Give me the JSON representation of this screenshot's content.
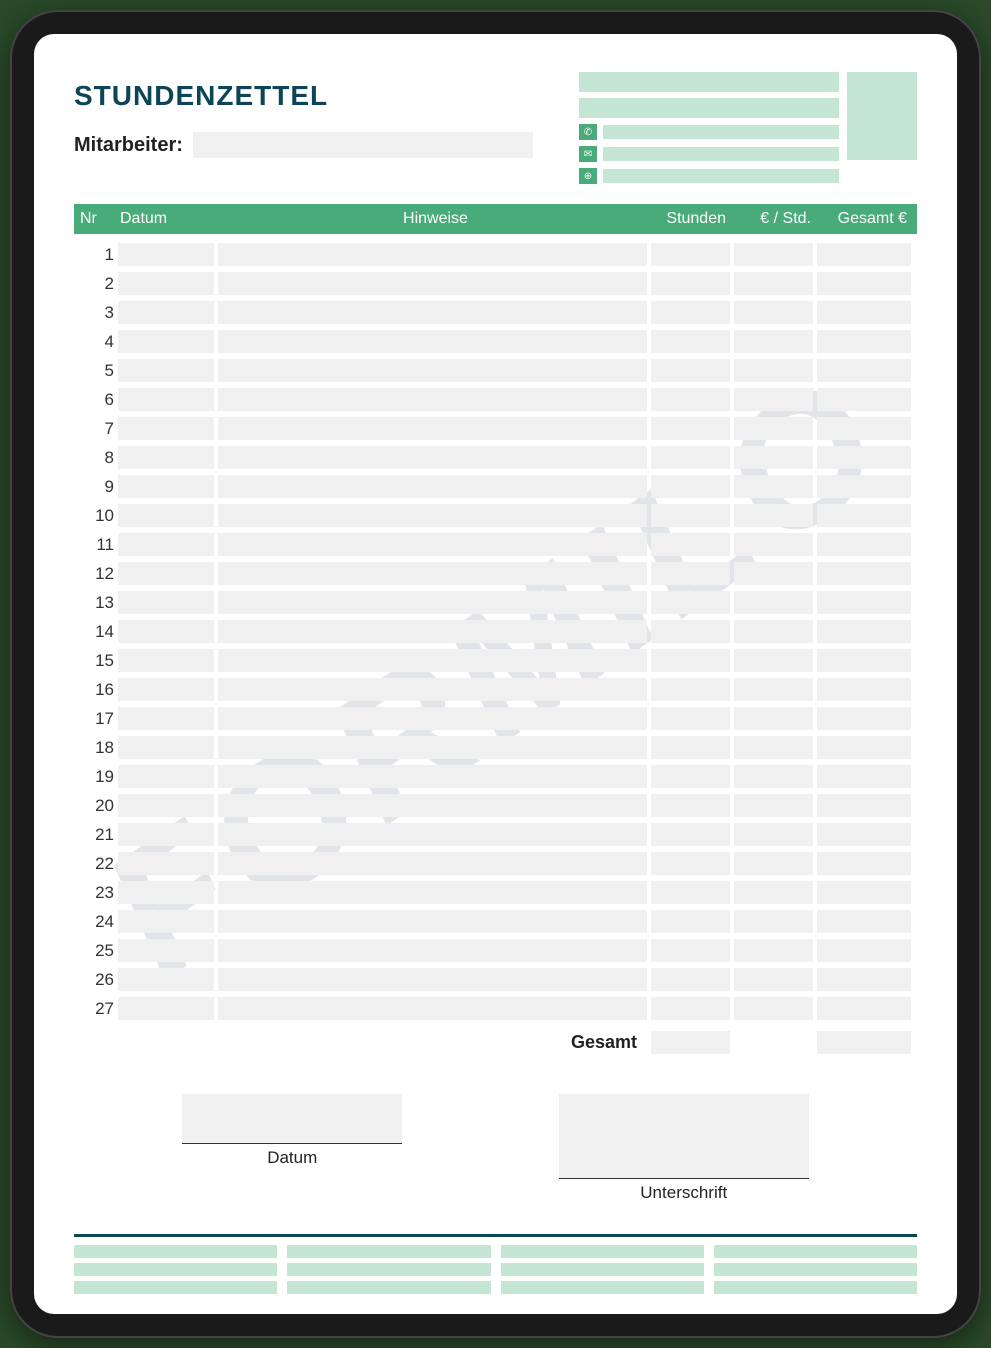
{
  "title": "STUNDENZETTEL",
  "employee_label": "Mitarbeiter:",
  "watermark": "FORMILO",
  "table": {
    "headers": {
      "nr": "Nr",
      "datum": "Datum",
      "hinweise": "Hinweise",
      "stunden": "Stunden",
      "rate": "€ / Std.",
      "gesamt": "Gesamt €"
    },
    "row_count": 27,
    "rows": [
      1,
      2,
      3,
      4,
      5,
      6,
      7,
      8,
      9,
      10,
      11,
      12,
      13,
      14,
      15,
      16,
      17,
      18,
      19,
      20,
      21,
      22,
      23,
      24,
      25,
      26,
      27
    ]
  },
  "total_label": "Gesamt",
  "signature": {
    "date_label": "Datum",
    "sign_label": "Unterschrift"
  },
  "contact_icons": [
    "phone",
    "mail",
    "web"
  ]
}
